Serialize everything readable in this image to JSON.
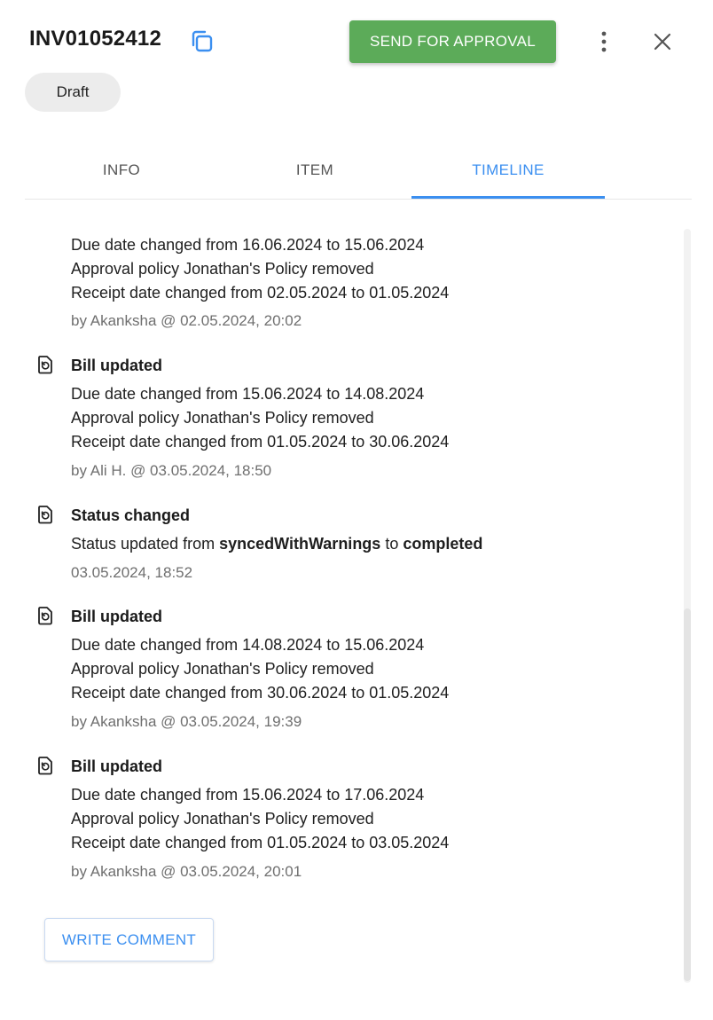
{
  "header": {
    "invoice_number": "INV01052412",
    "send_for_approval_label": "SEND FOR APPROVAL",
    "status_chip": "Draft"
  },
  "icons": {
    "copy": "copy-icon",
    "more": "more-vert-icon",
    "close": "close-icon",
    "event": "document-history-icon"
  },
  "colors": {
    "accent_blue": "#3b8ff0",
    "approve_green": "#5cab59",
    "chip_grey": "#ececec"
  },
  "tabs": [
    {
      "label": "INFO",
      "active": false
    },
    {
      "label": "ITEM",
      "active": false
    },
    {
      "label": "TIMELINE",
      "active": true
    }
  ],
  "timeline": {
    "events": [
      {
        "title": "",
        "lines": [
          "Due date changed from 16.06.2024 to 15.06.2024",
          "Approval policy Jonathan's Policy removed",
          "Receipt date changed from 02.05.2024 to 01.05.2024"
        ],
        "meta": "by Akanksha @ 02.05.2024, 20:02"
      },
      {
        "title": "Bill updated",
        "lines": [
          "Due date changed from 15.06.2024 to 14.08.2024",
          "Approval policy Jonathan's Policy removed",
          "Receipt date changed from 01.05.2024 to 30.06.2024"
        ],
        "meta": "by Ali H. @ 03.05.2024, 18:50"
      },
      {
        "title": "Status changed",
        "status_line": {
          "prefix": "Status updated from",
          "from": "syncedWithWarnings",
          "middle": "to",
          "to": "completed"
        },
        "meta": "03.05.2024, 18:52"
      },
      {
        "title": "Bill updated",
        "lines": [
          "Due date changed from 14.08.2024 to 15.06.2024",
          "Approval policy Jonathan's Policy removed",
          "Receipt date changed from 30.06.2024 to 01.05.2024"
        ],
        "meta": "by Akanksha @ 03.05.2024, 19:39"
      },
      {
        "title": "Bill updated",
        "lines": [
          "Due date changed from 15.06.2024 to 17.06.2024",
          "Approval policy Jonathan's Policy removed",
          "Receipt date changed from 01.05.2024 to 03.05.2024"
        ],
        "meta": "by Akanksha @ 03.05.2024, 20:01"
      }
    ]
  },
  "actions": {
    "write_comment_label": "WRITE COMMENT"
  }
}
